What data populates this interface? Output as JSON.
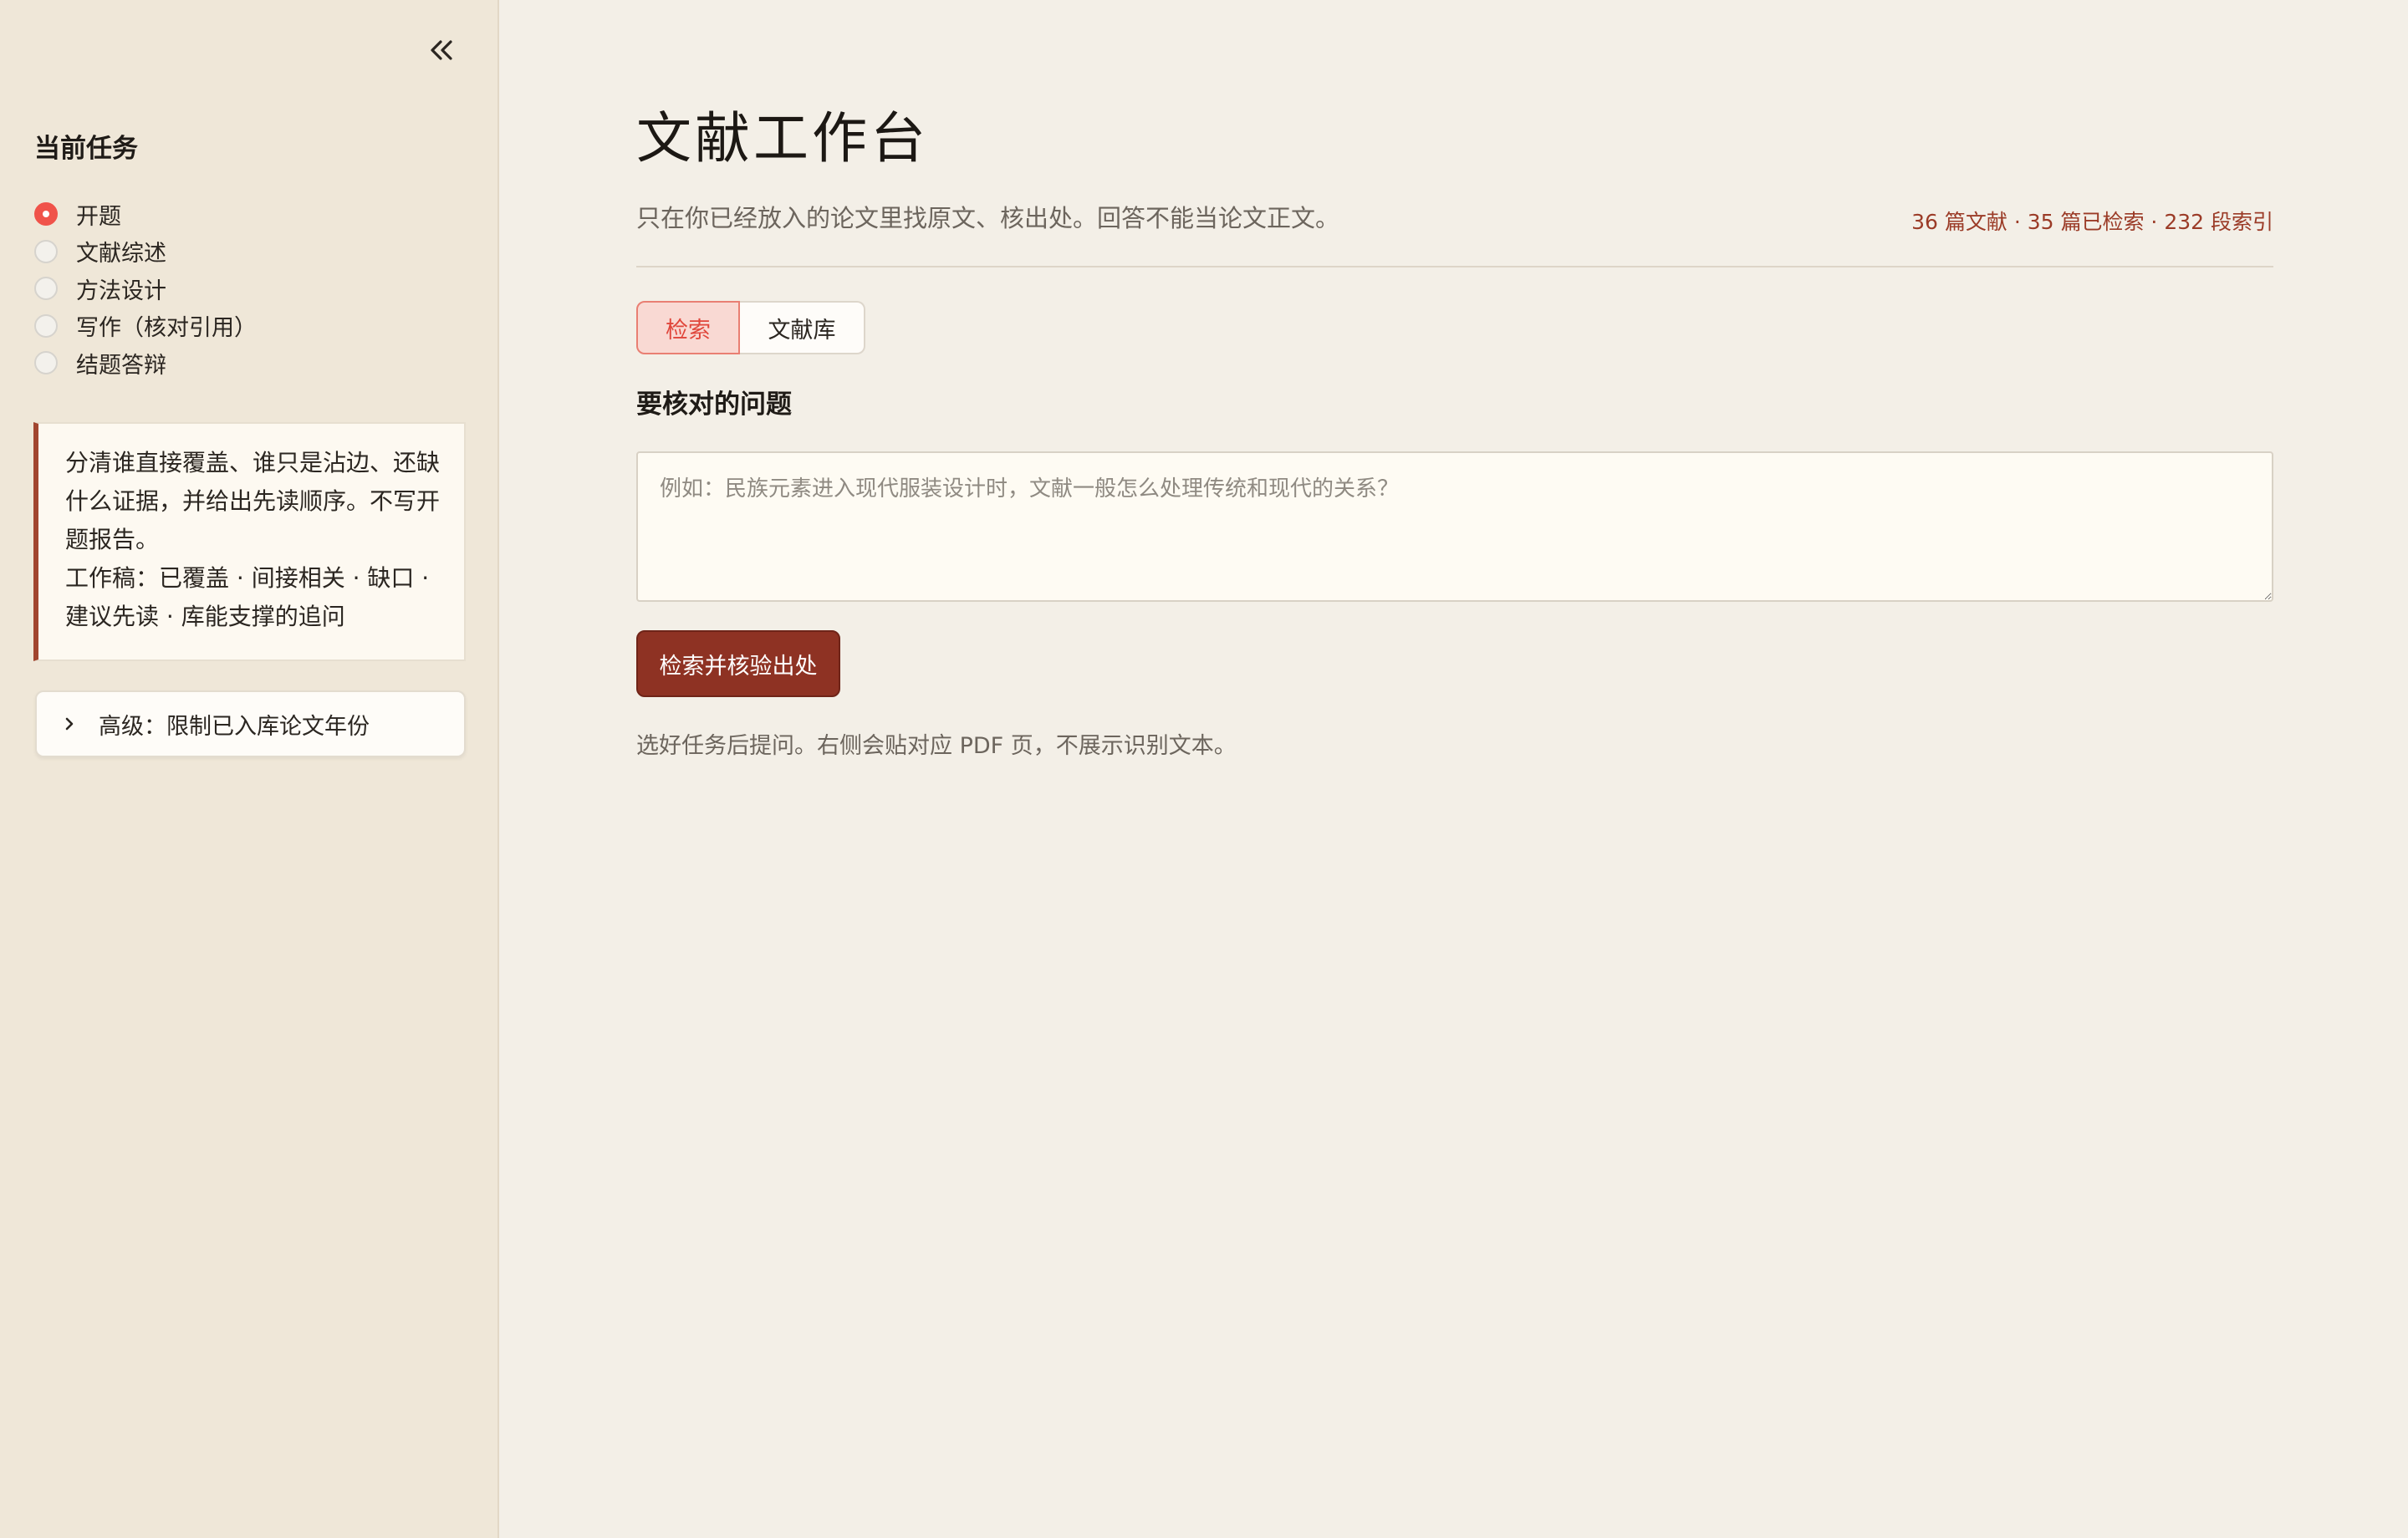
{
  "sidebar": {
    "heading": "当前任务",
    "tasks": [
      {
        "label": "开题",
        "selected": true
      },
      {
        "label": "文献综述",
        "selected": false
      },
      {
        "label": "方法设计",
        "selected": false
      },
      {
        "label": "写作（核对引用）",
        "selected": false
      },
      {
        "label": "结题答辩",
        "selected": false
      }
    ],
    "note": {
      "line1": "分清谁直接覆盖、谁只是沾边、还缺什么证据，并给出先读顺序。不写开题报告。",
      "line2": "工作稿：已覆盖 · 间接相关 · 缺口 · 建议先读 · 库能支撑的追问"
    },
    "advanced_label": "高级：限制已入库论文年份",
    "icons": {
      "collapse": "double-chevron-left-icon",
      "expand": "chevron-right-icon"
    }
  },
  "main": {
    "title": "文献工作台",
    "subtitle": "只在你已经放入的论文里找原文、核出处。回答不能当论文正文。",
    "stats": "36 篇文献 · 35 篇已检索 · 232 段索引",
    "tabs": [
      {
        "label": "检索",
        "active": true
      },
      {
        "label": "文献库",
        "active": false
      }
    ],
    "question_label": "要核对的问题",
    "question_placeholder": "例如：民族元素进入现代服装设计时，文献一般怎么处理传统和现代的关系？",
    "question_value": "",
    "submit_label": "检索并核验出处",
    "hint": "选好任务后提问。右侧会贴对应 PDF 页，不展示识别文本。"
  },
  "colors": {
    "accent": "#8e3223",
    "radio_selected": "#f0534a",
    "tab_active_bg": "#f9d9d3",
    "tab_active_text": "#e0463b",
    "sidebar_bg": "#efe7d8",
    "main_bg": "#f3efe7",
    "stats_text": "#9b3b27"
  }
}
